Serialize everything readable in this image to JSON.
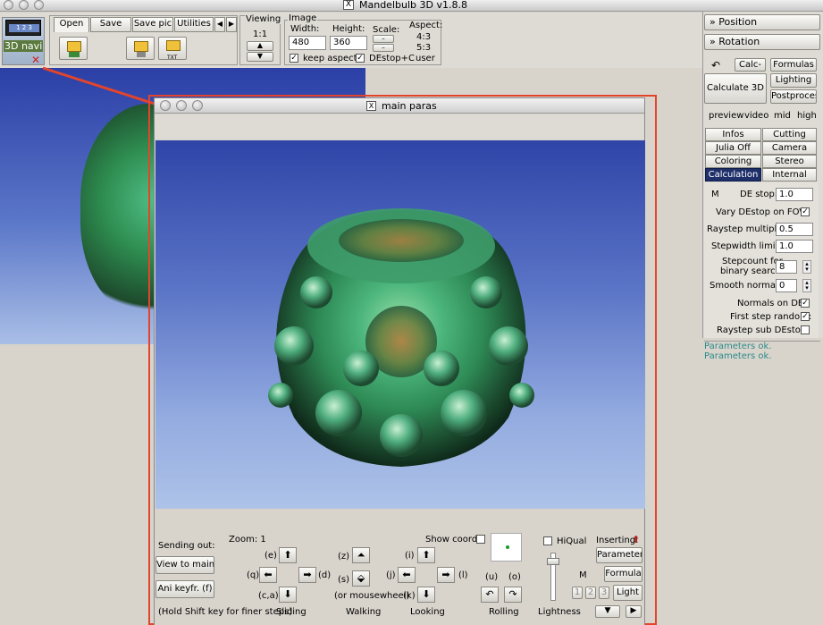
{
  "window": {
    "title": "Mandelbulb 3D   v1.8.8"
  },
  "toolbar": {
    "nav_3d_label": "3D navi",
    "tabs": [
      "Open",
      "Save",
      "Save pic",
      "Utilities"
    ],
    "viewing_label": "Viewing",
    "viewing_ratio": "1:1",
    "image_group_label": "Image",
    "width_label": "Width:",
    "width_value": "480",
    "height_label": "Height:",
    "height_value": "360",
    "scale_label": "Scale:",
    "aspect_label": "Aspect:",
    "aspect_options": [
      "4:3",
      "5:3",
      "user"
    ],
    "keep_aspect_label": "keep aspect",
    "destop_c_label": "DEstop+C",
    "save_icon_label": "TXT"
  },
  "right_panel": {
    "position_label": "» Position",
    "rotation_label": "» Rotation",
    "calc_label": "Calc-",
    "formulas_label": "Formulas",
    "calculate_3d_label": "Calculate 3D",
    "lighting_label": "Lighting",
    "postprocess_label": "Postprocess",
    "quality_options": [
      "preview",
      "video",
      "mid",
      "high"
    ],
    "tabs": [
      [
        "Infos",
        "Cutting"
      ],
      [
        "Julia Off",
        "Camera"
      ],
      [
        "Coloring",
        "Stereo"
      ],
      [
        "Calculation",
        "Internal"
      ]
    ],
    "m_label": "M",
    "de_stop_label": "DE stop:",
    "de_stop_value": "1.0",
    "vary_destop_label": "Vary DEstop on FOV:",
    "raystep_mult_label": "Raystep multiplier:",
    "raystep_mult_value": "0.5",
    "stepwidth_label": "Stepwidth limiter:",
    "stepwidth_value": "1.0",
    "stepcount_label1": "Stepcount for",
    "stepcount_label2": "binary search:",
    "stepcount_value": "8",
    "smooth_normals_label": "Smooth  normals:",
    "smooth_normals_value": "0",
    "normals_on_de_label": "Normals on DE:",
    "first_step_random_label": "First step random:",
    "raystep_sub_label": "Raystep sub DEstop:",
    "log_lines": [
      "Parameters ok.",
      "Parameters ok."
    ]
  },
  "main_paras": {
    "title": "main paras",
    "sending_out_label": "Sending out:",
    "view_to_main_label": "View to main",
    "ani_keyfr_label": "Ani keyfr. (f)",
    "shift_hint": "(Hold Shift key for finer steps)",
    "zoom_label": "Zoom: 1",
    "sliding_label": "Sliding",
    "walking_label": "Walking",
    "looking_label": "Looking",
    "rolling_label": "Rolling",
    "lightness_label": "Lightness",
    "show_coords_label": "Show coords",
    "hiqual_label": "HiQual",
    "inserting_label": "Inserting:",
    "parameter_label": "Parameter",
    "formula_label": "Formula",
    "light_label": "Light",
    "m_label": "M",
    "light_nums": [
      "1",
      "2",
      "3"
    ],
    "key_e": "(e)",
    "key_q": "(q)",
    "key_d": "(d)",
    "key_ca": "(c,a)",
    "key_z": "(z)",
    "key_s": "(s)",
    "mousewheel": "(or mousewheel)",
    "key_i_top": "(i)",
    "key_j": "(j)",
    "key_l": "(l)",
    "key_k": "(k)",
    "key_u": "(u)",
    "key_o": "(o)"
  },
  "colors": {
    "selected_tab": "#1f2f6a",
    "log_text": "#2a8a8a",
    "annotation_red": "#e2452c",
    "sky_top": "#2f45a8",
    "sky_bottom": "#aec3e8"
  }
}
